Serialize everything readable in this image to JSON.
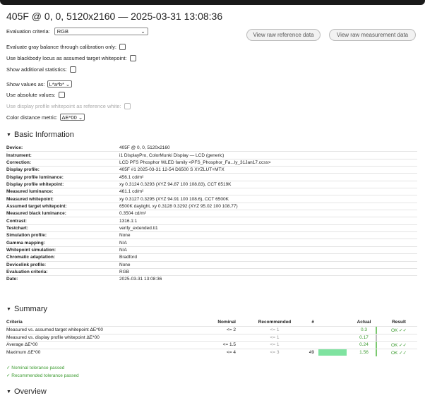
{
  "page": {
    "title": "405F @ 0, 0, 5120x2160 — 2025-03-31 13:08:36"
  },
  "controls": {
    "criteria_label": "Evaluation criteria:",
    "criteria_value": "RGB",
    "btn_reference": "View raw reference data",
    "btn_measurement": "View raw measurement data",
    "gray_balance_label": "Evaluate gray balance through calibration only:",
    "blackbody_label": "Use blackbody locus as assumed target whitepoint:",
    "additional_stats_label": "Show additional statistics:",
    "show_values_label": "Show values as:",
    "show_values_value": "L*a*b*",
    "absolute_label": "Use absolute values:",
    "display_wp_label": "Use display profile whitepoint as reference white:",
    "color_distance_label": "Color distance metric:",
    "color_distance_value": "ΔE*00"
  },
  "basic": {
    "heading": "Basic Information",
    "rows": [
      {
        "key": "Device:",
        "value": "405F @ 0, 0, 5120x2160"
      },
      {
        "key": "Instrument:",
        "value": "i1 DisplayPro, ColorMunki Display — LCD (generic)"
      },
      {
        "key": "Correction:",
        "value": "LCD PFS Phosphor WLED family <PFS_Phosphor_Fa...ly_31Jan17.ccss>"
      },
      {
        "key": "Display profile:",
        "value": "405F #1 2025-03-31 12-54 D6500 S XYZLUT+MTX"
      },
      {
        "key": "Display profile luminance:",
        "value": "456.1 cd/m²"
      },
      {
        "key": "Display profile whitepoint:",
        "value": "xy 0.3124 0.3293 (XYZ 94.87 100 108.83), CCT 6519K"
      },
      {
        "key": "Measured luminance:",
        "value": "461.1 cd/m²"
      },
      {
        "key": "Measured whitepoint:",
        "value": "xy 0.3127 0.3295 (XYZ 94.91 100 108.6), CCT 6500K"
      },
      {
        "key": "Assumed target whitepoint:",
        "value": "6500K daylight, xy 0.3128 0.3292 (XYZ 95.02 100 108.77)"
      },
      {
        "key": "Measured black luminance:",
        "value": "0.3504 cd/m²"
      },
      {
        "key": "Contrast:",
        "value": "1316.1:1"
      },
      {
        "key": "Testchart:",
        "value": "verify_extended.ti1"
      },
      {
        "key": "Simulation profile:",
        "value": "None"
      },
      {
        "key": "Gamma mapping:",
        "value": "N/A"
      },
      {
        "key": "Whitepoint simulation:",
        "value": "N/A"
      },
      {
        "key": "Chromatic adaptation:",
        "value": "Bradford"
      },
      {
        "key": "Devicelink profile:",
        "value": "None"
      },
      {
        "key": "Evaluation criteria:",
        "value": "RGB"
      },
      {
        "key": "Date:",
        "value": "2025-03-31 13:08:36"
      }
    ]
  },
  "summary": {
    "heading": "Summary",
    "headers": {
      "criteria": "Criteria",
      "nominal": "Nominal",
      "recommended": "Recommended",
      "hash": "#",
      "actual": "Actual",
      "result": "Result"
    },
    "rows": [
      {
        "criteria": "Measured vs. assumed target whitepoint ΔE*00",
        "nominal": "<= 2",
        "recommended": "<= 1",
        "hash": "",
        "actual": "0.3",
        "bar_fraction": 0,
        "result": "OK ✓✓",
        "mark_color": "#7bc96f"
      },
      {
        "criteria": "Measured vs. display profile whitepoint ΔE*00",
        "nominal": "",
        "recommended": "<= 1",
        "hash": "",
        "actual": "0.17",
        "bar_fraction": 0,
        "result": "",
        "mark_color": "#bdbdbd"
      },
      {
        "criteria": "Average ΔE*00",
        "nominal": "<= 1.5",
        "recommended": "<= 1",
        "hash": "",
        "actual": "0.24",
        "bar_fraction": 0,
        "result": "OK ✓✓",
        "mark_color": "#7bc96f"
      },
      {
        "criteria": "Maximum ΔE*00",
        "nominal": "<= 4",
        "recommended": "<= 3",
        "hash": "49",
        "actual": "1.56",
        "bar_fraction": 1,
        "result": "OK ✓✓",
        "mark_color": "#7bc96f"
      }
    ],
    "msg_nominal": "✓ Nominal tolerance passed",
    "msg_recommended": "✓ Recommended tolerance passed"
  },
  "overview": {
    "heading": "Overview"
  },
  "colors": {
    "ok_green": "#3a9a2e",
    "bar_green": "#7fe3a0"
  }
}
